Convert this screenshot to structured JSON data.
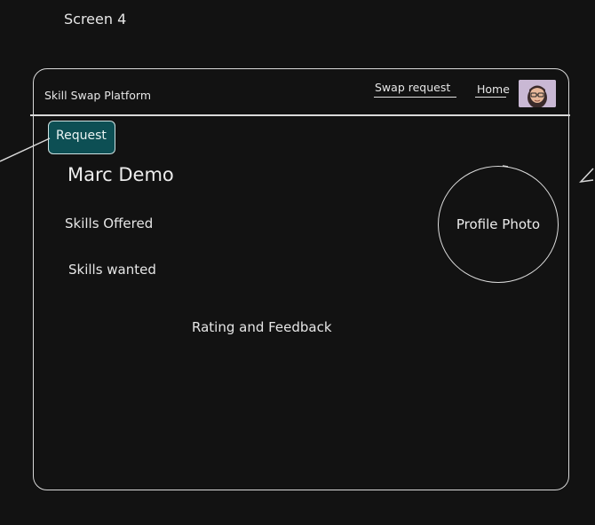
{
  "screen_label": "Screen 4",
  "header": {
    "app_title": "Skill Swap Platform",
    "nav": {
      "swap_request": "Swap request",
      "home": "Home"
    },
    "avatar_icon": "user-avatar-icon"
  },
  "profile": {
    "request_button": "Request",
    "name": "Marc Demo",
    "skills_offered": "Skills Offered",
    "skills_wanted": "Skills wanted",
    "rating_feedback": "Rating and Feedback",
    "photo_label": "Profile Photo"
  },
  "colors": {
    "background": "#121212",
    "request_button": "#0d4f54",
    "stroke": "#d9d9d9",
    "avatar_bg": "#c9b8d4"
  }
}
